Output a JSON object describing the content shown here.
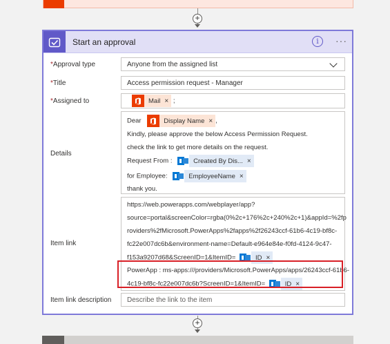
{
  "header": {
    "title": "Start an approval",
    "info_glyph": "i",
    "more_glyph": "···"
  },
  "fields": {
    "approval_type": {
      "label": "Approval type",
      "value": "Anyone from the assigned list"
    },
    "title": {
      "label": "Title",
      "value": "Access permission request - Manager"
    },
    "assigned_to": {
      "label": "Assigned to",
      "token": "Mail",
      "suffix": ";"
    },
    "details": {
      "label": "Details",
      "dear": "Dear",
      "dear_token": "Display Name",
      "dear_suffix": ",",
      "line1": "Kindly, please approve the below Access Permission Request.",
      "line2": "check the link to get more details on the request.",
      "request_from": "Request From :",
      "request_from_token": "Created By Dis...",
      "for_employee": "for Employee:",
      "for_employee_token": "EmployeeName",
      "thanks": "thank you."
    },
    "item_link": {
      "label": "Item link",
      "lines": [
        "https://web.powerapps.com/webplayer/app?",
        "source=portal&screenColor=rgba(0%2c+176%2c+240%2c+1)&appId=%2fp",
        "roviders%2fMicrosoft.PowerApps%2fapps%2f26243ccf-61b6-4c19-bf8c-",
        "fc22e007dc6b&environment-name=Default-e964e84e-f0fd-4124-9c47-",
        "f153a9207d68&ScreenID=1&ItemID="
      ],
      "token1": "ID",
      "powerapp_line1": "PowerApp : ms-apps:///providers/Microsoft.PowerApps/apps/26243ccf-61b6-",
      "powerapp_line2": "4c19-bf8c-fc22e007dc6b?ScreenID=1&ItemID=",
      "token2": "ID"
    },
    "item_link_description": {
      "label": "Item link description",
      "placeholder": "Describe the link to the item"
    }
  },
  "token_remove_glyph": "×",
  "required_marker": "*",
  "colors": {
    "accent": "#6059c8",
    "office": "#eb3c00",
    "highlight": "#d81f26"
  },
  "icons": [
    "approval-icon",
    "info-icon",
    "more-icon",
    "office-icon",
    "powerapps-icon",
    "add-icon",
    "chevron-down-icon"
  ]
}
